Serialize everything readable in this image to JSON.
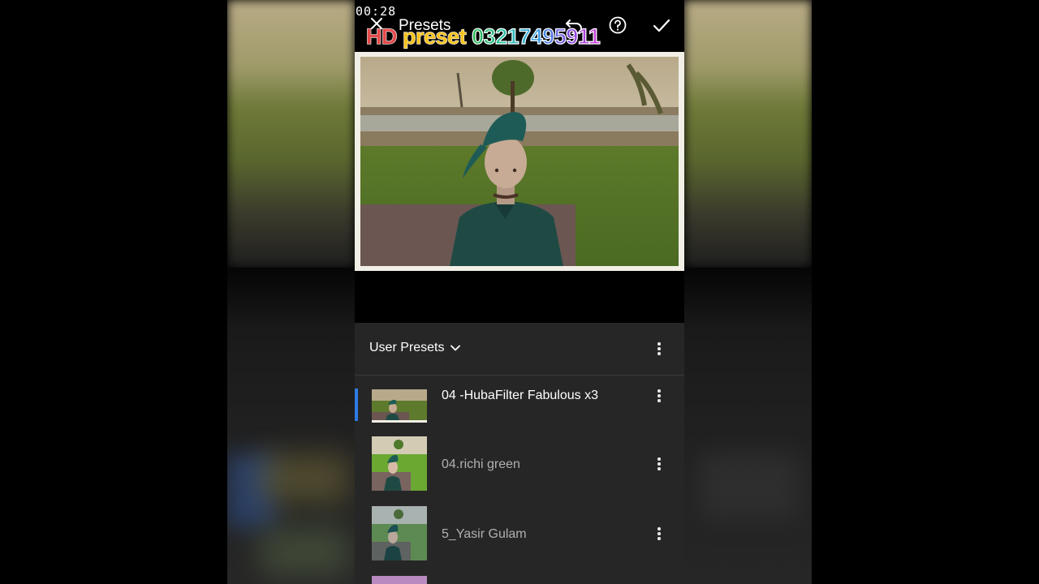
{
  "status_bar": {
    "time": "00:28"
  },
  "header": {
    "title": "Presets",
    "close_icon": "close-icon",
    "undo_icon": "undo-icon",
    "help_icon": "help-icon",
    "confirm_icon": "check-icon"
  },
  "watermark": {
    "hd": "HD",
    "preset": "preset",
    "phone": "03217495911"
  },
  "panel": {
    "group_label": "User Presets",
    "group_chevron": "chevron-down-icon",
    "menu_icon": "more-vertical-icon"
  },
  "presets": [
    {
      "name": "04 -HubaFilter Fabulous x3",
      "selected": true
    },
    {
      "name": "04.richi green",
      "selected": false
    },
    {
      "name": "5_Yasir Gulam",
      "selected": false
    }
  ],
  "colors": {
    "accent": "#2d7be4",
    "panel_bg": "#262626",
    "text_primary": "#ffffff",
    "text_secondary": "#b0b0b0"
  }
}
